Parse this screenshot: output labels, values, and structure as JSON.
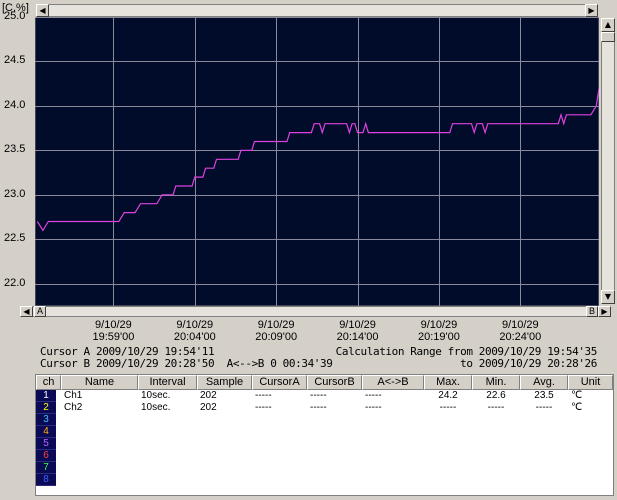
{
  "chart_data": {
    "type": "line",
    "ylabel": "[C,%]",
    "ylim": [
      21.75,
      25.0
    ],
    "yticks": [
      "25.0",
      "24.5",
      "24.0",
      "23.5",
      "23.0",
      "22.5",
      "22.0"
    ],
    "ytick_values": [
      25.0,
      24.5,
      24.0,
      23.5,
      23.0,
      22.5,
      22.0
    ],
    "xticks": [
      {
        "date": "9/10/29",
        "time": "19:59'00"
      },
      {
        "date": "9/10/29",
        "time": "20:04'00"
      },
      {
        "date": "9/10/29",
        "time": "20:09'00"
      },
      {
        "date": "9/10/29",
        "time": "20:14'00"
      },
      {
        "date": "9/10/29",
        "time": "20:19'00"
      },
      {
        "date": "9/10/29",
        "time": "20:24'00"
      }
    ],
    "x_range": [
      "2009/10/29 19:54:11",
      "2009/10/29 20:28:50"
    ],
    "grid": true,
    "series": [
      {
        "name": "Ch1",
        "color": "#e040e0",
        "points": [
          [
            "19:54:20",
            22.7
          ],
          [
            "19:54:40",
            22.6
          ],
          [
            "19:55:00",
            22.7
          ],
          [
            "19:59:20",
            22.7
          ],
          [
            "19:59:40",
            22.8
          ],
          [
            "20:00:20",
            22.8
          ],
          [
            "20:00:40",
            22.9
          ],
          [
            "20:01:40",
            22.9
          ],
          [
            "20:02:00",
            23.0
          ],
          [
            "20:02:40",
            23.0
          ],
          [
            "20:02:50",
            23.1
          ],
          [
            "20:03:50",
            23.1
          ],
          [
            "20:04:00",
            23.2
          ],
          [
            "20:04:30",
            23.2
          ],
          [
            "20:04:40",
            23.3
          ],
          [
            "20:05:10",
            23.3
          ],
          [
            "20:05:20",
            23.4
          ],
          [
            "20:06:40",
            23.4
          ],
          [
            "20:06:50",
            23.5
          ],
          [
            "20:07:30",
            23.5
          ],
          [
            "20:07:40",
            23.6
          ],
          [
            "20:09:40",
            23.6
          ],
          [
            "20:09:50",
            23.7
          ],
          [
            "20:11:10",
            23.7
          ],
          [
            "20:11:20",
            23.8
          ],
          [
            "20:11:40",
            23.8
          ],
          [
            "20:11:50",
            23.7
          ],
          [
            "20:12:00",
            23.8
          ],
          [
            "20:13:20",
            23.8
          ],
          [
            "20:13:30",
            23.7
          ],
          [
            "20:13:40",
            23.8
          ],
          [
            "20:13:50",
            23.8
          ],
          [
            "20:14:00",
            23.7
          ],
          [
            "20:14:20",
            23.7
          ],
          [
            "20:14:30",
            23.8
          ],
          [
            "20:14:40",
            23.7
          ],
          [
            "20:19:40",
            23.7
          ],
          [
            "20:19:50",
            23.8
          ],
          [
            "20:21:00",
            23.8
          ],
          [
            "20:21:10",
            23.7
          ],
          [
            "20:21:20",
            23.8
          ],
          [
            "20:21:40",
            23.8
          ],
          [
            "20:21:50",
            23.7
          ],
          [
            "20:22:00",
            23.8
          ],
          [
            "20:26:20",
            23.8
          ],
          [
            "20:26:30",
            23.9
          ],
          [
            "20:26:40",
            23.8
          ],
          [
            "20:26:50",
            23.9
          ],
          [
            "20:28:20",
            23.9
          ],
          [
            "20:28:40",
            24.0
          ],
          [
            "20:28:50",
            24.2
          ]
        ]
      }
    ]
  },
  "scroll": {
    "left_marker": "A",
    "right_marker": "B"
  },
  "cursor_info": {
    "line1_left": "Cursor A 2009/10/29 19:54'11",
    "line2_left": "Cursor B 2009/10/29 20:28'50  A<-->B 0 00:34'39",
    "line1_right": "Calculation Range from 2009/10/29 19:54'35",
    "line2_right": "to 2009/10/29 20:28'26"
  },
  "table": {
    "headers": [
      "ch",
      "Name",
      "Interval",
      "Sample",
      "CursorA",
      "CursorB",
      "A<->B",
      "Max.",
      "Min.",
      "Avg.",
      "Unit"
    ],
    "rows": [
      {
        "ch": "1",
        "color": "#ffffff",
        "name": "Ch1",
        "interval": "10sec.",
        "sample": "202",
        "cursor_a": "-----",
        "cursor_b": "-----",
        "ab": "-----",
        "max": "24.2",
        "min": "22.6",
        "avg": "23.5",
        "unit": "℃"
      },
      {
        "ch": "2",
        "color": "#ffff00",
        "name": "Ch2",
        "interval": "10sec.",
        "sample": "202",
        "cursor_a": "-----",
        "cursor_b": "-----",
        "ab": "-----",
        "max": "-----",
        "min": "-----",
        "avg": "-----",
        "unit": "℃"
      },
      {
        "ch": "3",
        "color": "#40c0ff"
      },
      {
        "ch": "4",
        "color": "#ffb000"
      },
      {
        "ch": "5",
        "color": "#c060ff"
      },
      {
        "ch": "6",
        "color": "#ff4040"
      },
      {
        "ch": "7",
        "color": "#40ff40"
      },
      {
        "ch": "8",
        "color": "#4060ff"
      }
    ]
  }
}
